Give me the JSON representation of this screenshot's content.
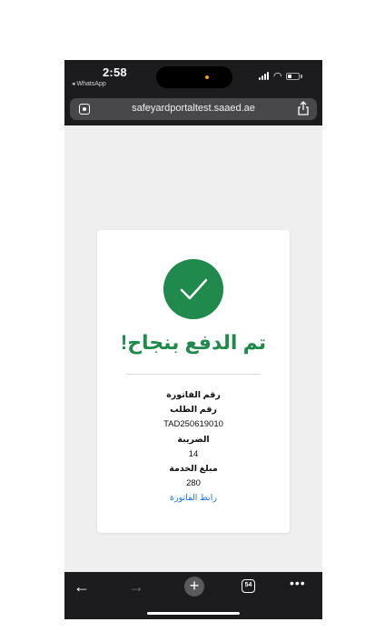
{
  "status_bar": {
    "time": "2:58",
    "back_app": "◂ WhatsApp"
  },
  "browser": {
    "url": "safeyardportaltest.saaed.ae",
    "tab_count": "54"
  },
  "payment": {
    "title": "تم الدفع بنجاح!",
    "invoice_number_label": "رقم الفاتورة",
    "order_number_label": "رقم الطلب",
    "order_number": "TAD250619010",
    "tax_label": "الضريبة",
    "tax_value": "14",
    "service_amount_label": "مبلغ الخدمة",
    "service_amount_value": "280",
    "invoice_link": "رابط الفاتورة"
  },
  "icons": {
    "back": "back-arrow-icon",
    "forward": "forward-arrow-icon",
    "new_tab": "plus-icon",
    "tabs": "tabs-icon",
    "more": "ellipsis-icon",
    "share": "share-icon",
    "check": "checkmark-icon"
  },
  "colors": {
    "success_green": "#1f8a4c",
    "link_blue": "#1a73e8",
    "chrome_dark": "#1c1c1e"
  }
}
